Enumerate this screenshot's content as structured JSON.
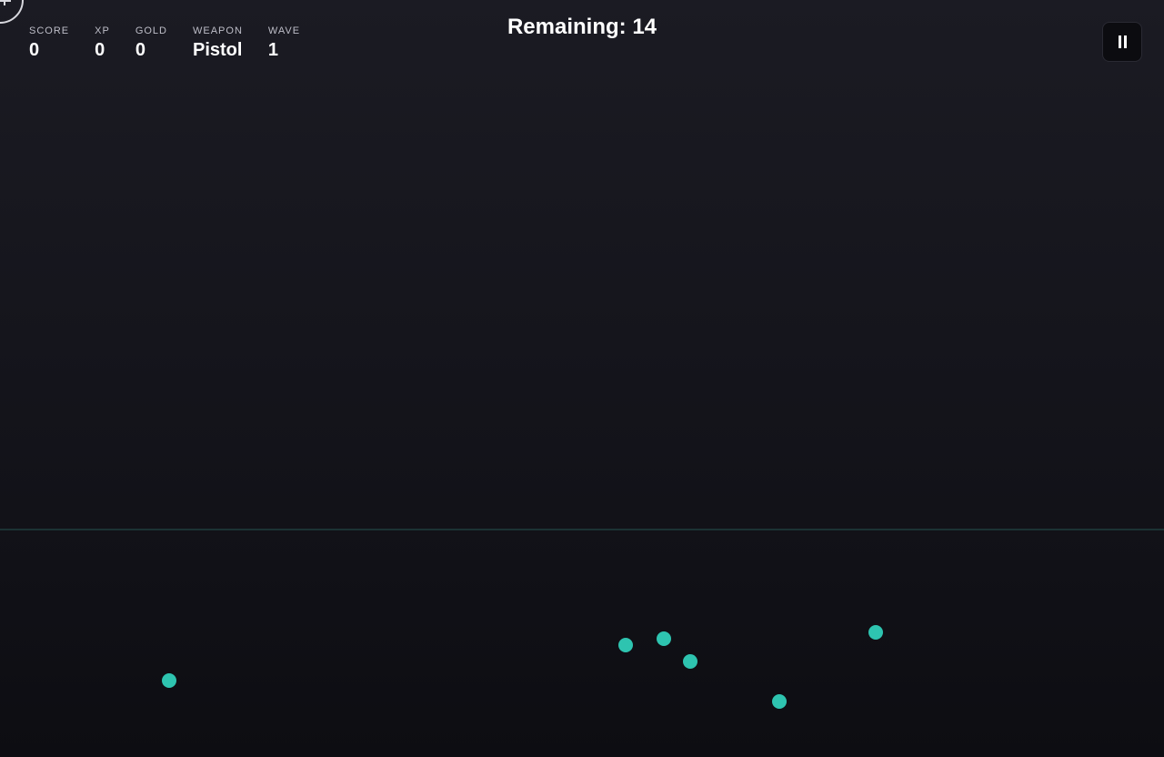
{
  "hud": {
    "stats": [
      {
        "label": "SCORE",
        "value": "0"
      },
      {
        "label": "XP",
        "value": "0"
      },
      {
        "label": "GOLD",
        "value": "0"
      },
      {
        "label": "WEAPON",
        "value": "Pistol"
      },
      {
        "label": "WAVE",
        "value": "1"
      }
    ]
  },
  "remaining_text": "Remaining: 14",
  "pause_icon": "pause-icon",
  "colors": {
    "enemy": "#2ec4b0",
    "ground_line": "#1f3a3a",
    "background_top": "#1b1b23",
    "background_bottom": "#0d0d12"
  }
}
